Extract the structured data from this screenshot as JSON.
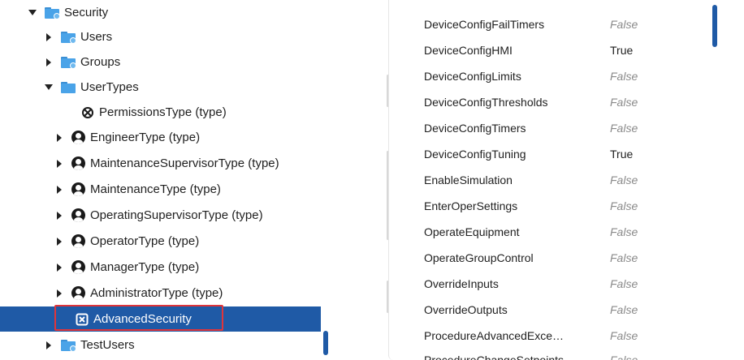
{
  "tree": {
    "items": [
      {
        "label": "Security",
        "level": 0,
        "expanded": true,
        "icon": "folder-icon"
      },
      {
        "label": "Users",
        "level": 1,
        "expanded": false,
        "icon": "folder-icon"
      },
      {
        "label": "Groups",
        "level": 1,
        "expanded": false,
        "icon": "folder-icon"
      },
      {
        "label": "UserTypes",
        "level": 1,
        "expanded": true,
        "icon": "folder-icon"
      },
      {
        "label": "PermissionsType (type)",
        "level": 2,
        "icon": "permissions-icon"
      },
      {
        "label": "EngineerType (type)",
        "level": 2,
        "icon": "user-icon"
      },
      {
        "label": "MaintenanceSupervisorType (type)",
        "level": 2,
        "icon": "user-icon"
      },
      {
        "label": "MaintenanceType (type)",
        "level": 2,
        "icon": "user-icon"
      },
      {
        "label": "OperatingSupervisorType (type)",
        "level": 2,
        "icon": "user-icon"
      },
      {
        "label": "OperatorType (type)",
        "level": 2,
        "icon": "user-icon"
      },
      {
        "label": "ManagerType (type)",
        "level": 2,
        "icon": "user-icon"
      },
      {
        "label": "AdministratorType (type)",
        "level": 2,
        "icon": "user-icon"
      },
      {
        "label": "AdvancedSecurity",
        "level": 2,
        "selected": true,
        "icon": "permissions-icon"
      },
      {
        "label": "TestUsers",
        "level": 1,
        "expanded": false,
        "icon": "folder-icon"
      }
    ]
  },
  "properties": [
    {
      "name": "DeviceConfigFailTimers",
      "value": "False"
    },
    {
      "name": "DeviceConfigHMI",
      "value": "True"
    },
    {
      "name": "DeviceConfigLimits",
      "value": "False"
    },
    {
      "name": "DeviceConfigThresholds",
      "value": "False"
    },
    {
      "name": "DeviceConfigTimers",
      "value": "False"
    },
    {
      "name": "DeviceConfigTuning",
      "value": "True"
    },
    {
      "name": "EnableSimulation",
      "value": "False"
    },
    {
      "name": "EnterOperSettings",
      "value": "False"
    },
    {
      "name": "OperateEquipment",
      "value": "False"
    },
    {
      "name": "OperateGroupControl",
      "value": "False"
    },
    {
      "name": "OverrideInputs",
      "value": "False"
    },
    {
      "name": "OverrideOutputs",
      "value": "False"
    },
    {
      "name": "ProcedureAdvancedExce…",
      "value": "False"
    },
    {
      "name": "ProcedureChangeSetpoints",
      "value": "False"
    }
  ],
  "colors": {
    "selection": "#1f5aa6",
    "highlight_border": "#e0353a",
    "folder": "#4aa3e8",
    "false_text": "#8a8a8a"
  }
}
